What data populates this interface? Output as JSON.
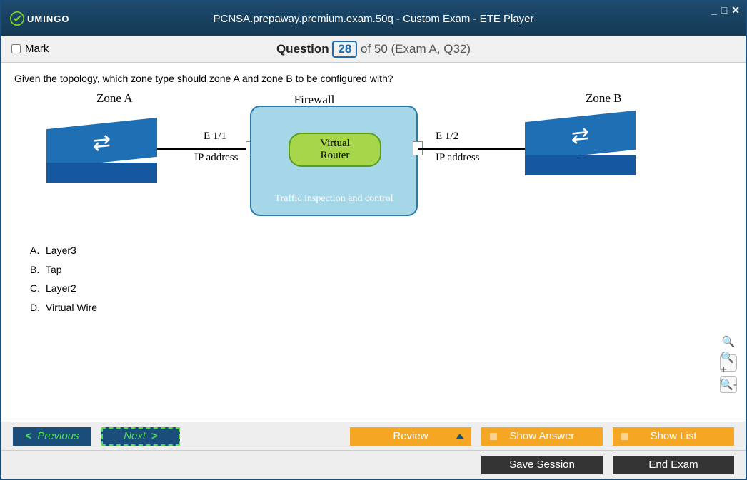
{
  "app": {
    "brand": "UMINGO",
    "title": "PCNSA.prepaway.premium.exam.50q - Custom Exam - ETE Player"
  },
  "questionbar": {
    "mark_label": "Mark",
    "question_label": "Question",
    "current": "28",
    "of_text": "of 50 (Exam A, Q32)"
  },
  "question": {
    "text": "Given the topology, which zone type should zone A and zone B to be configured with?",
    "diagram": {
      "zoneA": "Zone A",
      "zoneB": "Zone B",
      "firewall": "Firewall",
      "vr_line1": "Virtual",
      "vr_line2": "Router",
      "traffic": "Traffic inspection and control",
      "if1": "E 1/1",
      "ip1": "IP address",
      "if2": "E 1/2",
      "ip2": "IP address"
    },
    "answers": [
      {
        "letter": "A.",
        "text": "Layer3"
      },
      {
        "letter": "B.",
        "text": "Tap"
      },
      {
        "letter": "C.",
        "text": "Layer2"
      },
      {
        "letter": "D.",
        "text": "Virtual Wire"
      }
    ]
  },
  "footer": {
    "previous": "Previous",
    "next": "Next",
    "review": "Review",
    "show_answer": "Show Answer",
    "show_list": "Show List",
    "save_session": "Save Session",
    "end_exam": "End Exam"
  }
}
